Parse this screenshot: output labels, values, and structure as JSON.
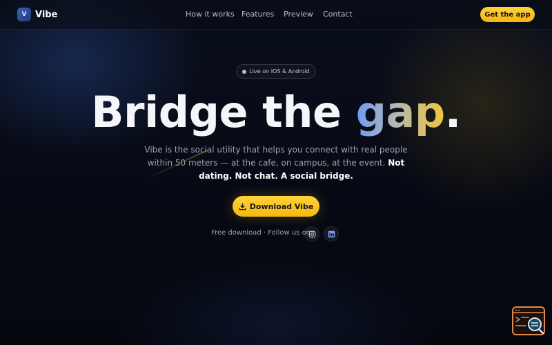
{
  "brand": {
    "name": "Vibe",
    "logo_letter": "V",
    "colors": {
      "accent": "#f5b710",
      "logo": "#2f4f9a",
      "background": "#06080f"
    }
  },
  "nav": {
    "items": [
      {
        "label": "How it works"
      },
      {
        "label": "Features"
      },
      {
        "label": "Preview"
      },
      {
        "label": "Contact"
      }
    ],
    "cta_label": "Get the app"
  },
  "hero": {
    "badge": "Live on IOS & Android",
    "headline_plain": "Bridge the ",
    "headline_gradient": "gap",
    "headline_end": ".",
    "description": "Vibe is the social utility that helps you connect with real people within 50 meters — at the cafe, on campus, at the event.",
    "description_strong": "Not dating. Not chat. A social bridge.",
    "download_label": "Download Vibe",
    "download_icon": "download-icon",
    "social_text": "Free download · Follow us on",
    "social_icons": [
      "instagram-icon",
      "linkedin-icon"
    ]
  },
  "widget": {
    "icon": "code-search-icon"
  }
}
